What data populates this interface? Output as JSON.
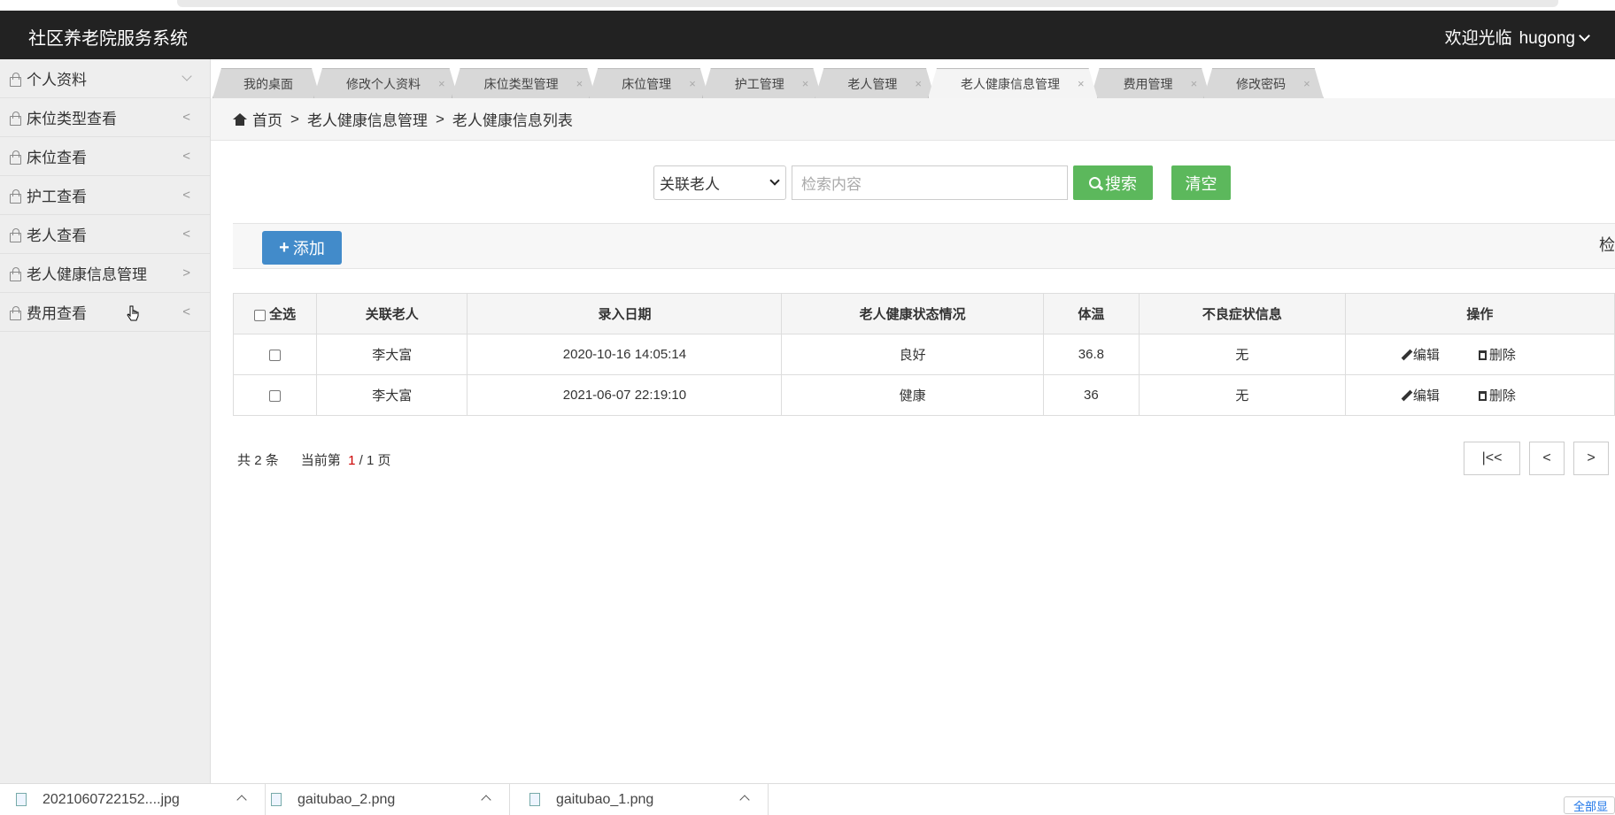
{
  "app": {
    "title": "社区养老院服务系统",
    "welcome": "欢迎光临",
    "user": "hugong"
  },
  "sidebar": {
    "items": [
      {
        "label": "个人资料",
        "arrow": "down"
      },
      {
        "label": "床位类型查看",
        "arrow": "<"
      },
      {
        "label": "床位查看",
        "arrow": "<"
      },
      {
        "label": "护工查看",
        "arrow": "<"
      },
      {
        "label": "老人查看",
        "arrow": "<"
      },
      {
        "label": "老人健康信息管理",
        "arrow": ">"
      },
      {
        "label": "费用查看",
        "arrow": "<"
      }
    ]
  },
  "tabs": [
    {
      "label": "我的桌面",
      "closable": false
    },
    {
      "label": "修改个人资料",
      "closable": true
    },
    {
      "label": "床位类型管理",
      "closable": true
    },
    {
      "label": "床位管理",
      "closable": true
    },
    {
      "label": "护工管理",
      "closable": true
    },
    {
      "label": "老人管理",
      "closable": true
    },
    {
      "label": "老人健康信息管理",
      "closable": true,
      "active": true
    },
    {
      "label": "费用管理",
      "closable": true
    },
    {
      "label": "修改密码",
      "closable": true
    }
  ],
  "tab_close": "×",
  "breadcrumb": {
    "home": "首页",
    "level1": "老人健康信息管理",
    "level2": "老人健康信息列表",
    "sep": ">"
  },
  "search": {
    "field": "关联老人",
    "placeholder": "检索内容",
    "search_label": "搜索",
    "clear_label": "清空"
  },
  "toolbar": {
    "add_label": "添加",
    "right_text": "检"
  },
  "table": {
    "headers": {
      "select_all": "全选",
      "elder": "关联老人",
      "date": "录入日期",
      "status": "老人健康状态情况",
      "temp": "体温",
      "symptom": "不良症状信息",
      "ops": "操作"
    },
    "rows": [
      {
        "elder": "李大富",
        "date": "2020-10-16 14:05:14",
        "status": "良好",
        "temp": "36.8",
        "symptom": "无"
      },
      {
        "elder": "李大富",
        "date": "2021-06-07 22:19:10",
        "status": "健康",
        "temp": "36",
        "symptom": "无"
      }
    ],
    "edit_label": "编辑",
    "delete_label": "删除"
  },
  "pager": {
    "total_prefix": "共",
    "total": "2",
    "total_suffix": "条",
    "current_prefix": "当前第",
    "current": "1",
    "pages": "/ 1 页",
    "first": "|<<",
    "prev": "<",
    "next": ">"
  },
  "downloads": [
    {
      "name": "2021060722152....jpg"
    },
    {
      "name": "gaitubao_2.png"
    },
    {
      "name": "gaitubao_1.png"
    }
  ],
  "downloads_all": "全部显"
}
